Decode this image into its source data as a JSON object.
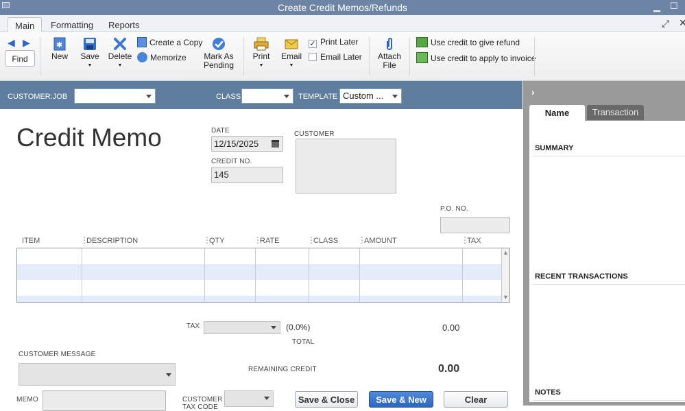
{
  "window": {
    "title": "Create Credit Memos/Refunds"
  },
  "tabs": [
    {
      "label": "Main"
    },
    {
      "label": "Formatting"
    },
    {
      "label": "Reports"
    }
  ],
  "toolbar": {
    "find": "Find",
    "new": "New",
    "save": "Save",
    "delete": "Delete",
    "create_copy": "Create a Copy",
    "memorize": "Memorize",
    "mark_as_pending_1": "Mark As",
    "mark_as_pending_2": "Pending",
    "print": "Print",
    "email": "Email",
    "print_later": "Print Later",
    "print_later_checked": true,
    "email_later": "Email Later",
    "attach_1": "Attach",
    "attach_2": "File",
    "use_credit_refund": "Use credit to give refund",
    "use_credit_invoice": "Use credit to apply to invoice"
  },
  "header": {
    "customer_job_label": "CUSTOMER:JOB",
    "customer_job_value": "",
    "class_label": "CLASS",
    "class_value": "",
    "template_label": "TEMPLATE",
    "template_value": "Custom ..."
  },
  "form": {
    "title": "Credit Memo",
    "date_label": "DATE",
    "date_value": "12/15/2025",
    "credit_no_label": "CREDIT NO.",
    "credit_no_value": "145",
    "customer_label": "CUSTOMER",
    "po_label": "P.O. NO.",
    "columns": [
      "ITEM",
      "DESCRIPTION",
      "QTY",
      "RATE",
      "CLASS",
      "AMOUNT",
      "TAX"
    ],
    "tax_label": "TAX",
    "tax_rate": "(0.0%)",
    "tax_amount": "0.00",
    "total_label": "TOTAL",
    "customer_message_label": "CUSTOMER MESSAGE",
    "remaining_credit_label": "REMAINING CREDIT",
    "remaining_credit_value": "0.00",
    "memo_label": "MEMO",
    "customer_tax_code_label_1": "CUSTOMER",
    "customer_tax_code_label_2": "TAX CODE"
  },
  "buttons": {
    "save_close": "Save & Close",
    "save_new": "Save & New",
    "clear": "Clear"
  },
  "sidebar": {
    "tab_name": "Name",
    "tab_transaction": "Transaction",
    "summary": "SUMMARY",
    "recent": "RECENT TRANSACTIONS",
    "notes": "NOTES"
  },
  "colors": {
    "titlebar": "#6d84a5",
    "header": "#5f7d9e",
    "row_alt": "#e3ecf8",
    "primary_button": "#2b66c0"
  }
}
